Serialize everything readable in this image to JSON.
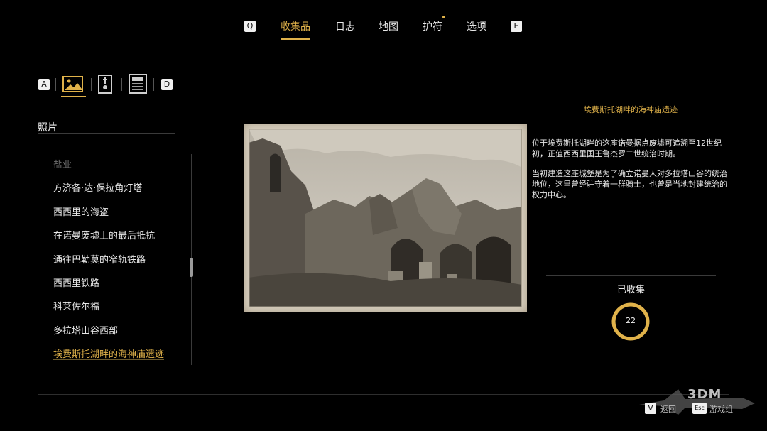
{
  "nav": {
    "prev_key": "Q",
    "next_key": "E",
    "tabs": [
      {
        "label": "收集品",
        "active": true
      },
      {
        "label": "日志",
        "active": false
      },
      {
        "label": "地图",
        "active": false
      },
      {
        "label": "护符",
        "active": false,
        "notification": true
      },
      {
        "label": "选项",
        "active": false
      }
    ]
  },
  "categories": {
    "prev_key": "A",
    "next_key": "D",
    "icons": [
      "photo-icon",
      "tombstone-icon",
      "document-icon"
    ],
    "active_index": 0
  },
  "section_title": "照片",
  "list": {
    "items": [
      {
        "label": "盐业",
        "state": "faded"
      },
      {
        "label": "方济各·达·保拉角灯塔",
        "state": "normal"
      },
      {
        "label": "西西里的海盗",
        "state": "normal"
      },
      {
        "label": "在诺曼废墟上的最后抵抗",
        "state": "normal"
      },
      {
        "label": "通往巴勒莫的窄轨铁路",
        "state": "normal"
      },
      {
        "label": "西西里铁路",
        "state": "normal"
      },
      {
        "label": "科莱佐尔福",
        "state": "normal"
      },
      {
        "label": "多拉塔山谷西部",
        "state": "normal"
      },
      {
        "label": "埃费斯托湖畔的海神庙遗迹",
        "state": "selected"
      }
    ]
  },
  "detail": {
    "title": "埃费斯托湖畔的海神庙遗迹",
    "paragraphs": [
      "位于埃费斯托湖畔的这座诺曼据点废墟可追溯至12世纪初，正值西西里国王鲁杰罗二世统治时期。",
      "当初建造这座城堡是为了确立诺曼人对多拉塔山谷的统治地位，这里曾经驻守着一群骑士，也曾是当地封建统治的权力中心。"
    ]
  },
  "collection": {
    "label": "已收集",
    "count": "22"
  },
  "footer": {
    "key_v": "V",
    "label_v": "返回",
    "key_esc": "Esc",
    "label_esc": "游戏组",
    "watermark": "3DM"
  },
  "colors": {
    "accent": "#e0b24a",
    "background": "#000000",
    "text": "#e6e6e6",
    "muted": "#6d6d6d"
  }
}
